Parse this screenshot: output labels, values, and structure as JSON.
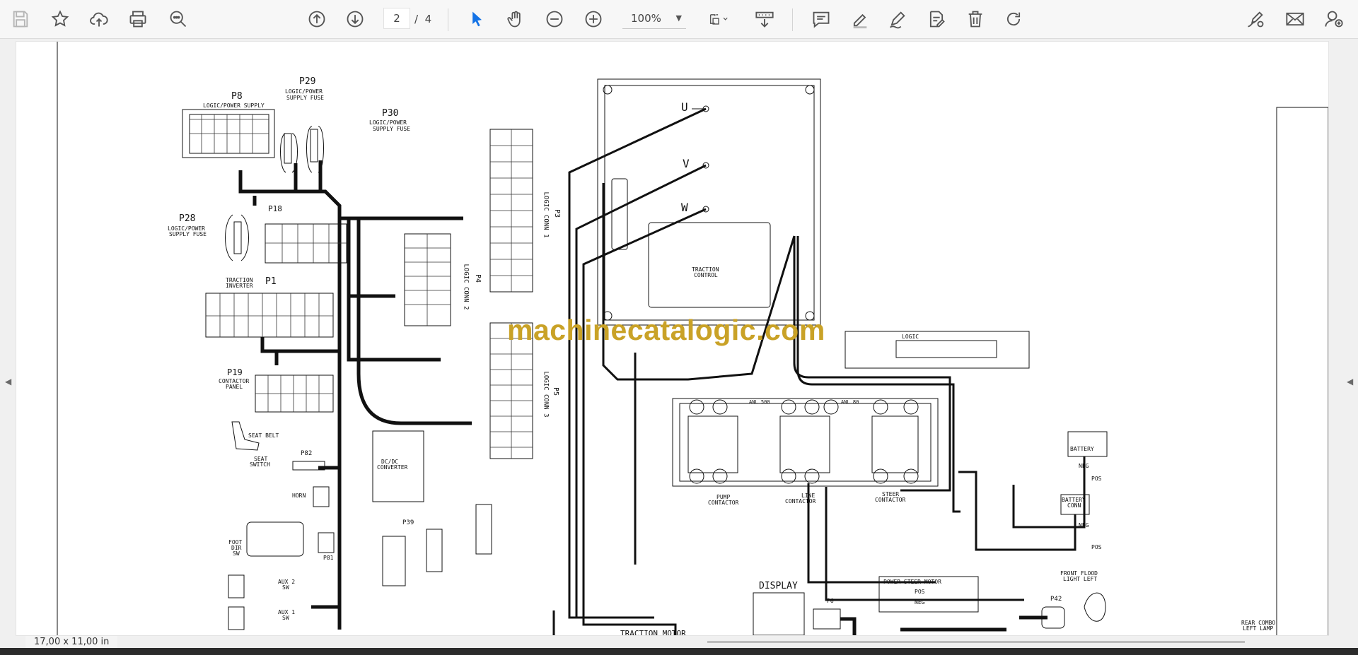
{
  "toolbar": {
    "current_page": "2",
    "page_sep": "/",
    "total_pages": "4",
    "zoom": "100%"
  },
  "status": {
    "page_size": "17,00 x 11,00 in"
  },
  "watermark": "machinecatalogic.com",
  "schematic": {
    "p8_id": "P8",
    "p8_desc": "LOGIC/POWER SUPPLY",
    "p29_id": "P29",
    "p29_desc1": "LOGIC/POWER",
    "p29_desc2": "SUPPLY FUSE",
    "p30_id": "P30",
    "p30_desc1": "LOGIC/POWER",
    "p30_desc2": "SUPPLY FUSE",
    "p28_id": "P28",
    "p28_desc1": "LOGIC/POWER",
    "p28_desc2": "SUPPLY FUSE",
    "p18_id": "P18",
    "p1_desc1": "TRACTION",
    "p1_desc2": "INVERTER",
    "p1_id": "P1",
    "p19_id": "P19",
    "p19_desc1": "CONTACTOR",
    "p19_desc2": "PANEL",
    "seat_belt": "SEAT BELT",
    "seat_switch1": "SEAT",
    "seat_switch2": "SWITCH",
    "p82_id": "P82",
    "horn": "HORN",
    "foot_dir1": "FOOT",
    "foot_dir2": "DIR",
    "foot_dir3": "SW",
    "p81_id": "P81",
    "aux2": "AUX 2",
    "aux1": "AUX 1",
    "sw": "SW",
    "dcdc1": "DC/DC",
    "dcdc2": "CONVERTER",
    "p39_id": "P39",
    "p3_id": "P3",
    "p3_desc": "LOGIC CONN 1",
    "p4_id": "P4",
    "p4_desc": "LOGIC CONN 2",
    "p5_id": "P5",
    "p5_desc": "LOGIC CONN 3",
    "u": "U",
    "v": "V",
    "w": "W",
    "traction_control1": "TRACTION",
    "traction_control2": "CONTROL",
    "logic": "LOGIC",
    "anl500": "ANL 500",
    "anl80": "ANL 80",
    "pump_contactor1": "PUMP",
    "pump_contactor2": "CONTACTOR",
    "line_contactor1": "LINE",
    "line_contactor2": "CONTACTOR",
    "steer_contactor1": "STEER",
    "steer_contactor2": "CONTACTOR",
    "battery": "BATTERY",
    "battery_conn1": "BATTERY",
    "battery_conn2": "CONN",
    "neg": "NEG",
    "pos": "POS",
    "display": "DISPLAY",
    "p6_id": "P6",
    "power_steer_motor": "POWER STEER MOTOR",
    "pos_term": "POS",
    "neg_term": "NEG",
    "front_flood1": "FRONT FLOOD",
    "front_flood2": "LIGHT LEFT",
    "p42_id": "P42",
    "rear_combo1": "REAR COMBO",
    "rear_combo2": "LEFT LAMP",
    "traction_motor": "TRACTION MOTOR"
  }
}
